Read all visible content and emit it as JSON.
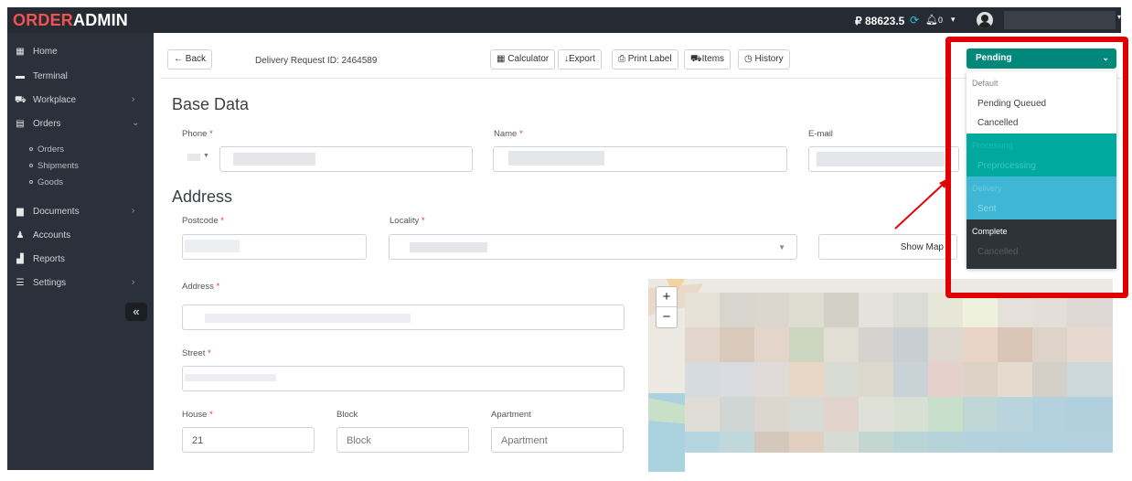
{
  "topbar": {
    "logo_part1": "ORDER",
    "logo_part2": "ADMIN",
    "balance": "₽ 88623.5",
    "notification_count": "0"
  },
  "sidebar": {
    "items": [
      {
        "label": "Home",
        "icon": "grid-icon"
      },
      {
        "label": "Terminal",
        "icon": "terminal-icon"
      },
      {
        "label": "Workplace",
        "icon": "truck-icon"
      },
      {
        "label": "Orders",
        "icon": "inbox-icon"
      },
      {
        "label": "Documents",
        "icon": "document-icon"
      },
      {
        "label": "Accounts",
        "icon": "user-icon"
      },
      {
        "label": "Reports",
        "icon": "report-icon"
      },
      {
        "label": "Settings",
        "icon": "sliders-icon"
      }
    ],
    "orders_sub": [
      "Orders",
      "Shipments",
      "Goods"
    ],
    "collapse_glyph": "«"
  },
  "toolbar": {
    "back": "← Back",
    "request_id": "Delivery Request ID: 2464589",
    "calculator": "Calculator",
    "export": "Export",
    "print_label": "Print Label",
    "items": "Items",
    "history": "History"
  },
  "base_data": {
    "title": "Base Data",
    "phone_label": "Phone",
    "name_label": "Name",
    "email_label": "E-mail"
  },
  "address": {
    "title": "Address",
    "postcode_label": "Postcode",
    "locality_label": "Locality",
    "show_map": "Show Map",
    "address_label": "Address",
    "street_label": "Street",
    "house_label": "House",
    "house_value": "21",
    "block_label": "Block",
    "block_placeholder": "Block",
    "apartment_label": "Apartment",
    "apartment_placeholder": "Apartment"
  },
  "status_dropdown": {
    "selected": "Pending",
    "groups": [
      {
        "header": "Default",
        "items": [
          "Pending Queued",
          "Cancelled"
        ],
        "color": "#ffffff"
      },
      {
        "header": "Processing",
        "items": [
          "Preprocessing"
        ],
        "color": "#00a99d"
      },
      {
        "header": "Delivery",
        "items": [
          "Sent"
        ],
        "color": "#3eb6d4"
      },
      {
        "header": "Complete",
        "items": [
          "Cancelled"
        ],
        "color": "#2e3339"
      }
    ]
  },
  "map": {
    "zoom_in": "+",
    "zoom_out": "−"
  },
  "colors": {
    "sidebar_bg": "#2b313a",
    "status_green": "#00897b",
    "highlight_red": "#e00000",
    "required_star": "#e53935"
  }
}
